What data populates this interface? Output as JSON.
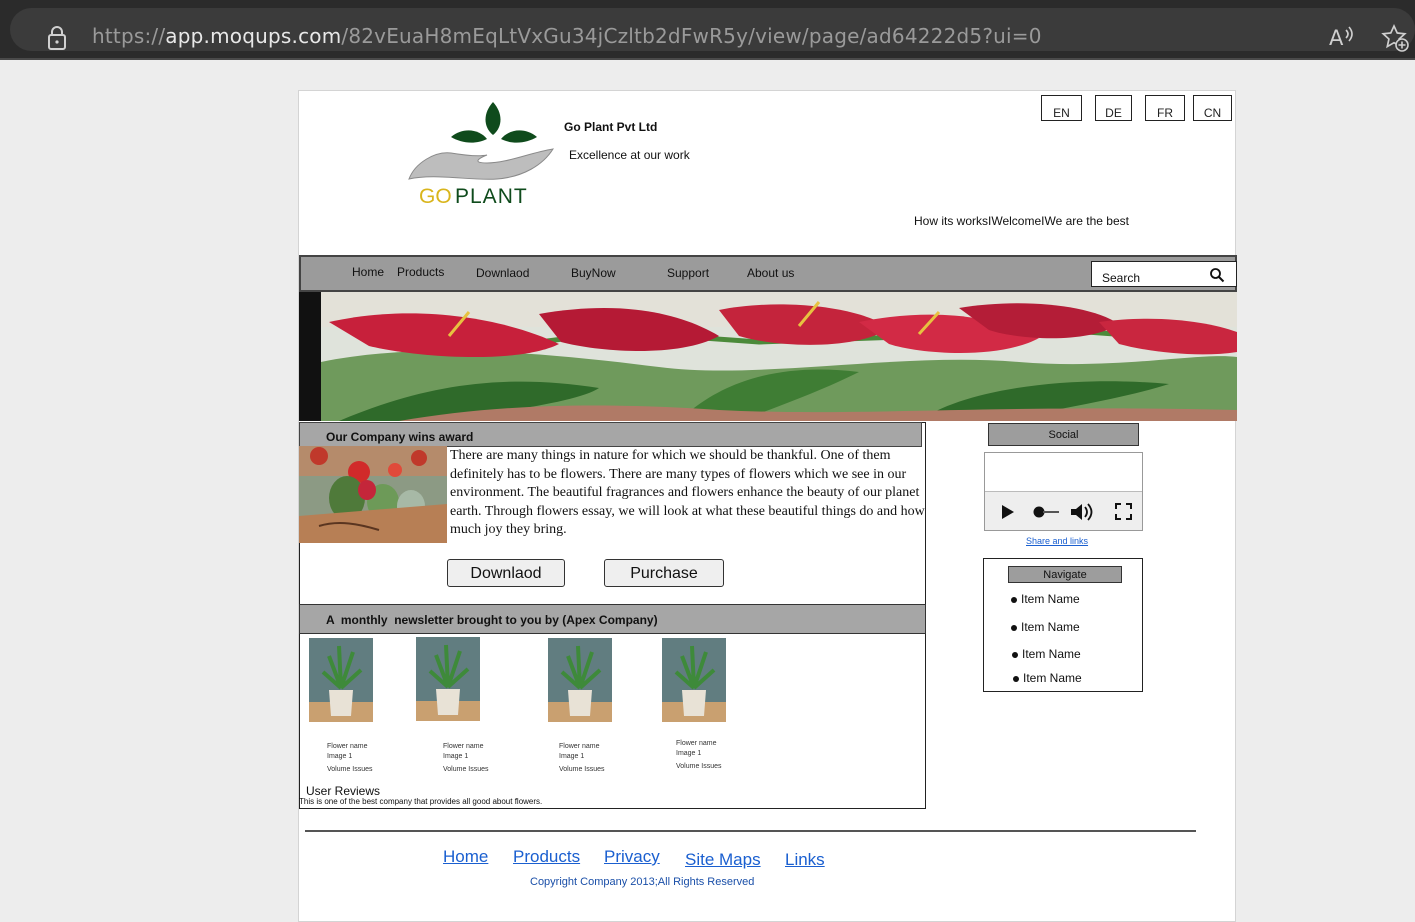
{
  "browser": {
    "url_prefix": "https://",
    "url_host": "app.moqups.com",
    "url_path": "/82vEuaH8mEqLtVxGu34jCzltb2dFwR5y/view/page/ad64222d5?ui=0",
    "icons": [
      "lock-icon",
      "read-aloud-icon",
      "favorites-add-icon"
    ]
  },
  "header": {
    "logo_text_go": "GO",
    "logo_text_plant": "PLANT",
    "company_name": "Go Plant Pvt Ltd",
    "tagline": "Excellence at our work",
    "languages": [
      "EN",
      "DE",
      "FR",
      "CN"
    ],
    "top_links": "How its worksIWelcomeIWe are the best"
  },
  "nav": {
    "items": [
      "Home",
      "Products",
      "Downlaod",
      "BuyNow",
      "Support",
      "About us"
    ],
    "search_label": "Search"
  },
  "award": {
    "title": "Our Company wins award",
    "text": "There are many things in nature for which we should be thankful. One of them definitely has to be flowers. There are many types of flowers which we see in our environment. The beautiful fragrances and flowers enhance the beauty of our planet earth. Through flowers essay, we will look at what these beautiful things do and how much joy they bring.",
    "buttons": [
      "Downlaod",
      "Purchase"
    ]
  },
  "newsletter": {
    "title": "A  monthly  newsletter brought to you by (Apex Company)",
    "items": [
      {
        "line1": "Flower name",
        "line2": "Image 1",
        "line3": "Volume Issues"
      },
      {
        "line1": "Flower name",
        "line2": "Image 1",
        "line3": "Volume Issues"
      },
      {
        "line1": "Flower name",
        "line2": "Image 1",
        "line3": "Volume Issues"
      },
      {
        "line1": "Flower name",
        "line2": "Image 1",
        "line3": "Volume Issues"
      }
    ]
  },
  "reviews": {
    "title": "User Reviews",
    "text": "This is one of the best company that provides all good about flowers."
  },
  "sidebar": {
    "social_label": "Social",
    "share_link": "Share and links",
    "navigate_label": "Navigate",
    "nav_items": [
      "Item Name",
      "Item Name",
      "Item Name",
      "Item Name"
    ]
  },
  "footer": {
    "links": [
      "Home",
      "Products",
      "Privacy",
      "Site Maps",
      "Links"
    ],
    "copyright": "Copyright  Company 2013;All Rights Reserved"
  },
  "colors": {
    "nav_bg": "#9b9b9b",
    "link_blue": "#1a5fd0",
    "logo_green": "#0f4b1c",
    "logo_yellow": "#d9b51c"
  }
}
